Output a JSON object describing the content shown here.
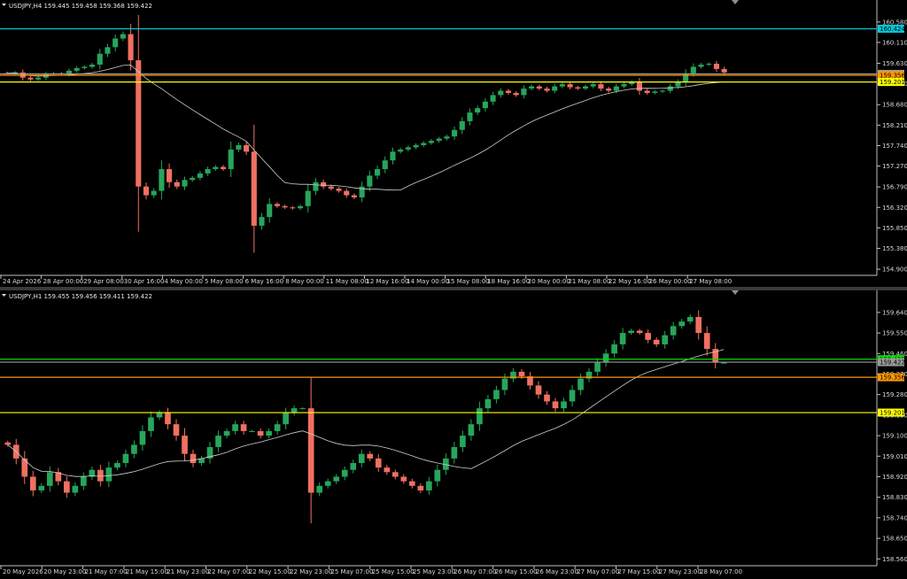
{
  "panels": [
    {
      "symbol_text": "USDJPY,H4  159.445 159.458 159.368 159.422",
      "price_range": [
        154.76,
        160.82
      ],
      "y_ticks": [
        "160.580",
        "160.110",
        "159.630",
        "159.160",
        "158.680",
        "158.210",
        "157.740",
        "157.270",
        "156.790",
        "156.320",
        "155.850",
        "155.380",
        "154.900"
      ],
      "x_labels": [
        "24 Apr 2026",
        "28 Apr 00:00",
        "29 Apr 08:00",
        "30 Apr 16:00",
        "4 May 00:00",
        "5 May 08:00",
        "6 May 16:00",
        "8 May 00:00",
        "11 May 08:00",
        "12 May 16:00",
        "14 May 00:00",
        "15 May 08:00",
        "18 May 16:00",
        "20 May 00:00",
        "21 May 08:00",
        "22 May 16:00",
        "26 May 00:00",
        "27 May 08:00"
      ],
      "hlines": [
        {
          "price": 160.424,
          "label": "160.424",
          "color": "#00c8d8",
          "label_bg": "#00c8d8"
        },
        {
          "price": 159.388,
          "label": "159.388",
          "color": "#9a9a9a",
          "label_bg": "#9a9a9a"
        },
        {
          "price": 159.356,
          "label": "159.356",
          "color": "#ff9900",
          "label_bg": "#ff9900"
        },
        {
          "price": 159.201,
          "label": "159.201",
          "color": "#ffff00",
          "label_bg": "#ffff00"
        }
      ]
    },
    {
      "symbol_text": "USDJPY,H1  159.455 159.456 159.411 159.422",
      "price_range": [
        158.53,
        159.69
      ],
      "y_ticks": [
        "159.640",
        "159.550",
        "159.460",
        "159.370",
        "159.280",
        "159.190",
        "159.100",
        "159.010",
        "158.920",
        "158.830",
        "158.740",
        "158.650",
        "158.560"
      ],
      "x_labels": [
        "20 May 2026",
        "20 May 23:00",
        "21 May 07:00",
        "21 May 15:00",
        "21 May 23:00",
        "22 May 07:00",
        "22 May 15:00",
        "22 May 23:00",
        "25 May 07:00",
        "25 May 15:00",
        "25 May 23:00",
        "26 May 07:00",
        "26 May 15:00",
        "26 May 23:00",
        "27 May 07:00",
        "27 May 15:00",
        "27 May 23:00",
        "28 May 07:00"
      ],
      "hlines": [
        {
          "price": 159.435,
          "label": "159.435",
          "color": "#00e000",
          "label_bg": "#00e000"
        },
        {
          "price": 159.422,
          "label": "159.422",
          "color": "#9a9a9a",
          "label_bg": "#9a9a9a"
        },
        {
          "price": 159.356,
          "label": "159.356",
          "color": "#ff9900",
          "label_bg": "#ff9900"
        },
        {
          "price": 159.201,
          "label": "159.201",
          "color": "#ffff00",
          "label_bg": "#ffff00"
        }
      ]
    }
  ],
  "chart_data": [
    {
      "type": "candlestick",
      "colors": {
        "up": "#26a65b",
        "down": "#f07060",
        "ma": "#cfcfcf"
      },
      "series": [
        {
          "name": "",
          "values": [
            159.4,
            159.42,
            159.3,
            159.26,
            159.3,
            159.38,
            159.4,
            159.38,
            159.46,
            159.52,
            159.55,
            159.6,
            159.85,
            160.0,
            160.2,
            160.3,
            159.7,
            156.8,
            156.6,
            156.7,
            157.2,
            156.9,
            156.8,
            156.95,
            157.0,
            157.1,
            157.2,
            157.25,
            157.2,
            157.65,
            157.75,
            157.6,
            155.9,
            156.1,
            156.4,
            156.35,
            156.32,
            156.3,
            156.35,
            156.7,
            156.9,
            156.8,
            156.75,
            156.7,
            156.6,
            156.55,
            156.8,
            157.05,
            157.2,
            157.4,
            157.6,
            157.65,
            157.7,
            157.75,
            157.8,
            157.85,
            157.9,
            157.95,
            158.1,
            158.3,
            158.5,
            158.6,
            158.75,
            158.9,
            159.0,
            158.95,
            158.9,
            159.05,
            159.1,
            159.05,
            159.0,
            159.1,
            159.15,
            159.08,
            159.05,
            159.1,
            159.15,
            159.05,
            159.0,
            159.1,
            159.15,
            159.2,
            159.0,
            158.95,
            158.98,
            159.0,
            159.1,
            159.2,
            159.4,
            159.55,
            159.6,
            159.62,
            159.5,
            159.42
          ]
        }
      ]
    },
    {
      "type": "candlestick",
      "colors": {
        "up": "#26a65b",
        "down": "#f07060",
        "ma": "#cfcfcf"
      },
      "series": [
        {
          "name": "",
          "values": [
            159.06,
            159.0,
            158.92,
            158.86,
            158.88,
            158.94,
            158.9,
            158.85,
            158.88,
            158.92,
            158.95,
            158.9,
            158.96,
            158.98,
            159.02,
            159.06,
            159.12,
            159.18,
            159.2,
            159.15,
            159.1,
            159.02,
            158.98,
            159.0,
            159.05,
            159.1,
            159.12,
            159.15,
            159.12,
            159.12,
            159.1,
            159.12,
            159.15,
            159.2,
            159.22,
            159.22,
            158.85,
            158.88,
            158.9,
            158.92,
            158.95,
            158.98,
            159.02,
            159.0,
            158.96,
            158.94,
            158.92,
            158.9,
            158.88,
            158.86,
            158.9,
            158.95,
            159.0,
            159.05,
            159.1,
            159.15,
            159.22,
            159.26,
            159.3,
            159.35,
            159.38,
            159.36,
            159.32,
            159.28,
            159.25,
            159.22,
            159.25,
            159.3,
            159.35,
            159.38,
            159.42,
            159.46,
            159.5,
            159.55,
            159.56,
            159.55,
            159.52,
            159.5,
            159.54,
            159.58,
            159.6,
            159.62,
            159.55,
            159.48,
            159.42,
            159.42
          ]
        }
      ]
    }
  ]
}
